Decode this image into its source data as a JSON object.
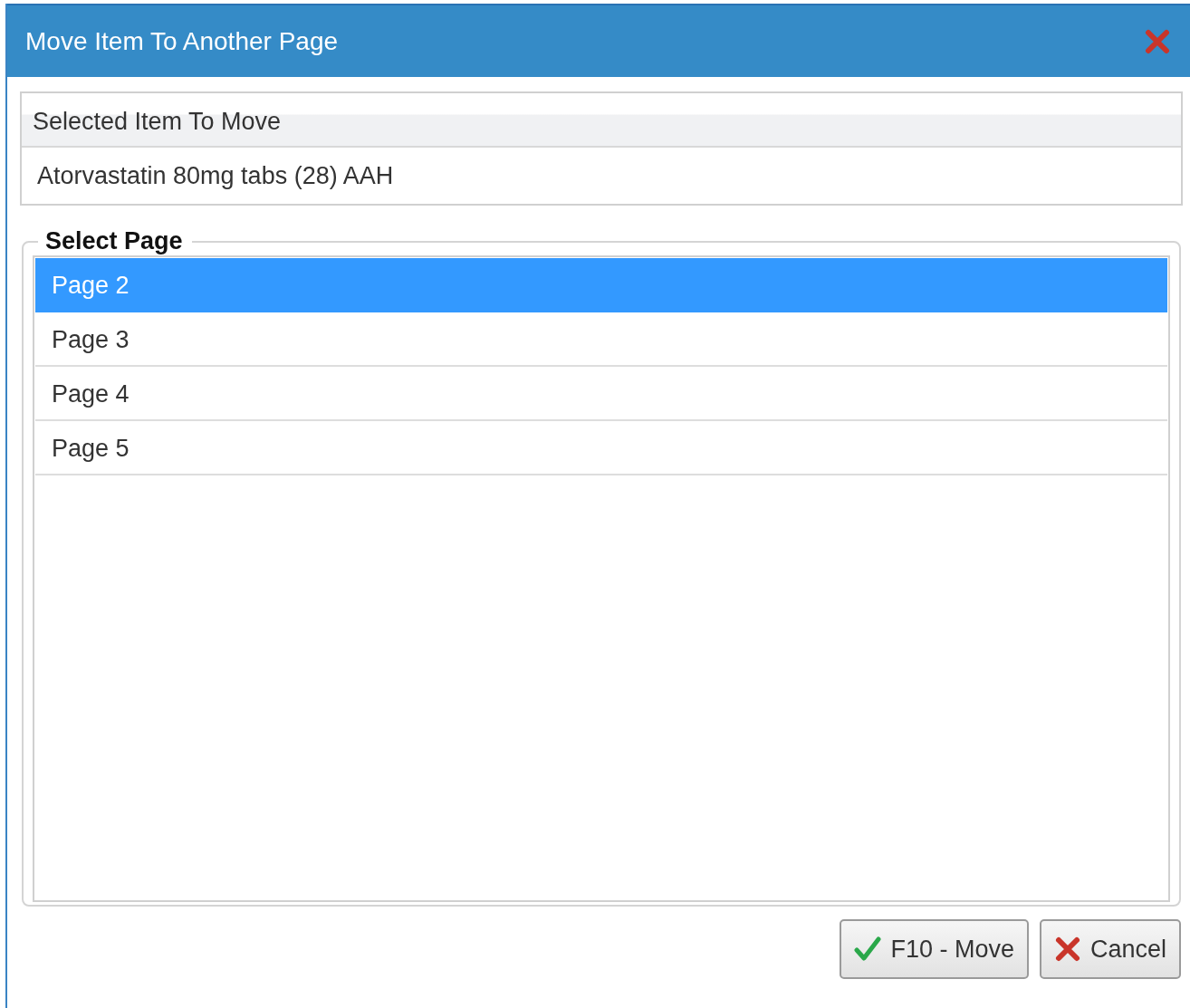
{
  "window": {
    "title": "Move Item To Another Page"
  },
  "selected_item": {
    "header": "Selected Item To Move",
    "value": "Atorvastatin 80mg tabs (28) AAH"
  },
  "select_page": {
    "title": "Select Page",
    "pages": [
      {
        "label": "Page 2",
        "selected": true
      },
      {
        "label": "Page 3",
        "selected": false
      },
      {
        "label": "Page 4",
        "selected": false
      },
      {
        "label": "Page 5",
        "selected": false
      }
    ]
  },
  "buttons": [
    {
      "kind": "confirm",
      "label": "F10 - Move"
    },
    {
      "kind": "cancel",
      "label": "Cancel"
    }
  ]
}
